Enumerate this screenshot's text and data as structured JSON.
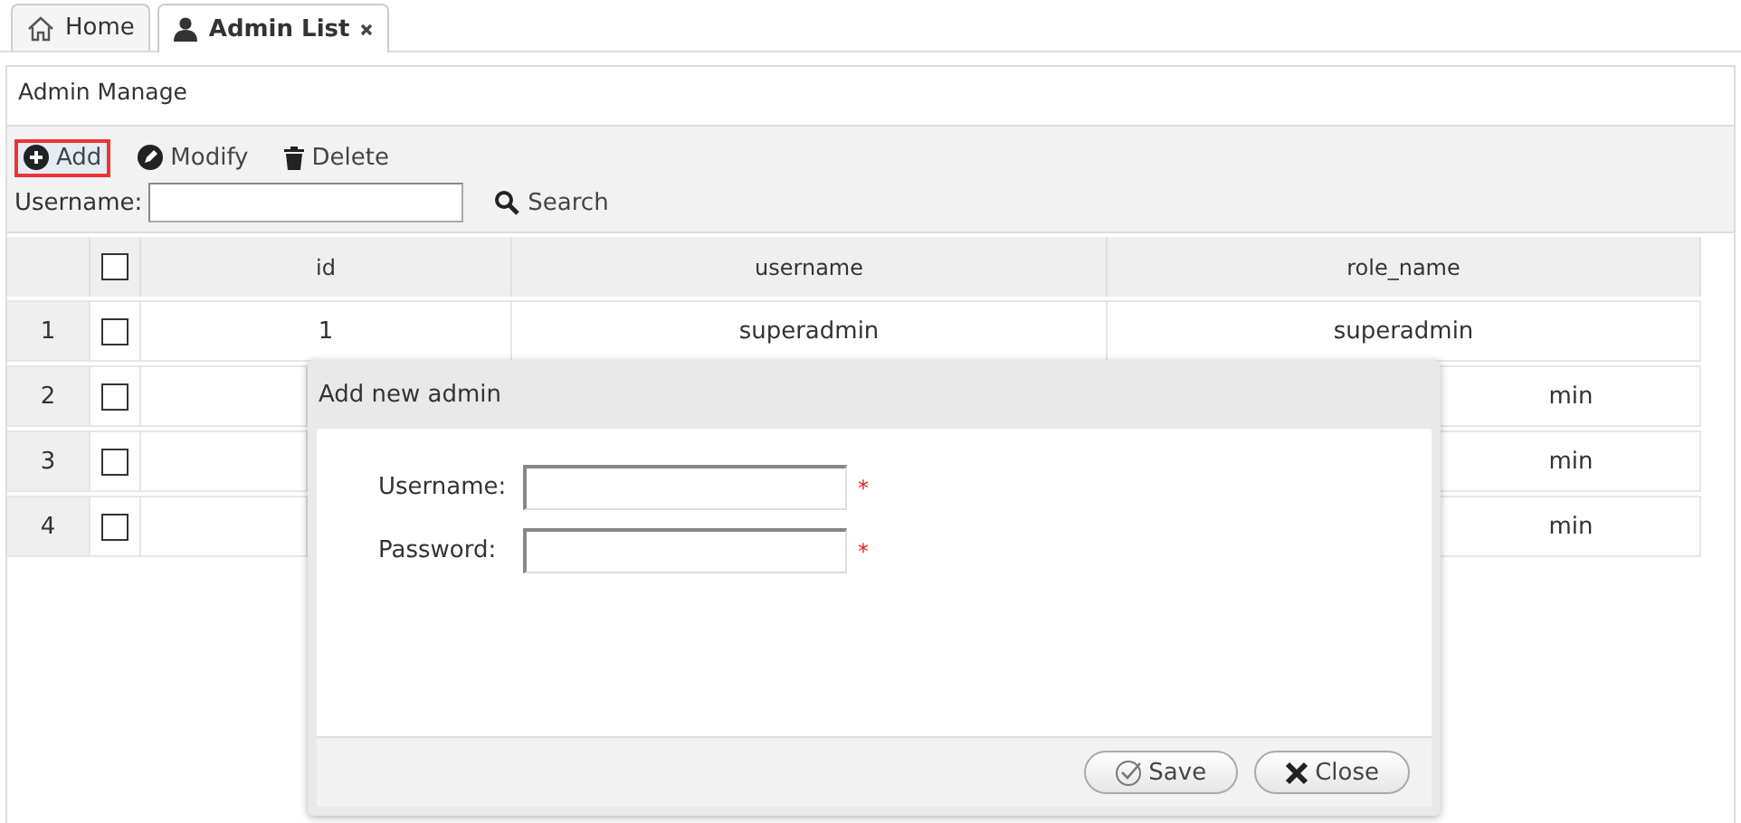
{
  "tabs": [
    {
      "label": "Home",
      "selected": false,
      "closable": false
    },
    {
      "label": "Admin List",
      "selected": true,
      "closable": true
    }
  ],
  "panel": {
    "title": "Admin Manage"
  },
  "toolbar": [
    {
      "label": "Add",
      "selected": true
    },
    {
      "label": "Modify",
      "selected": false
    },
    {
      "label": "Delete",
      "selected": false
    }
  ],
  "search": {
    "label": "Username:",
    "button": "Search"
  },
  "table": {
    "all_checked": false,
    "columns": [
      "id",
      "username",
      "role_name"
    ],
    "rows": [
      {
        "number": "1",
        "checked": false,
        "id": "1",
        "username": "superadmin",
        "role_name": "superadmin"
      },
      {
        "number": "2",
        "checked": false,
        "role_name": "min"
      },
      {
        "number": "3",
        "checked": false,
        "role_name": "min"
      },
      {
        "number": "4",
        "checked": false,
        "role_name": "min"
      }
    ]
  },
  "dialog": {
    "title": "Add new admin",
    "fields": [
      {
        "label": "Username:",
        "marker": "*"
      },
      {
        "label": "Password:",
        "marker": "*"
      }
    ],
    "buttons": [
      {
        "label": "Save"
      },
      {
        "label": "Close"
      }
    ]
  }
}
